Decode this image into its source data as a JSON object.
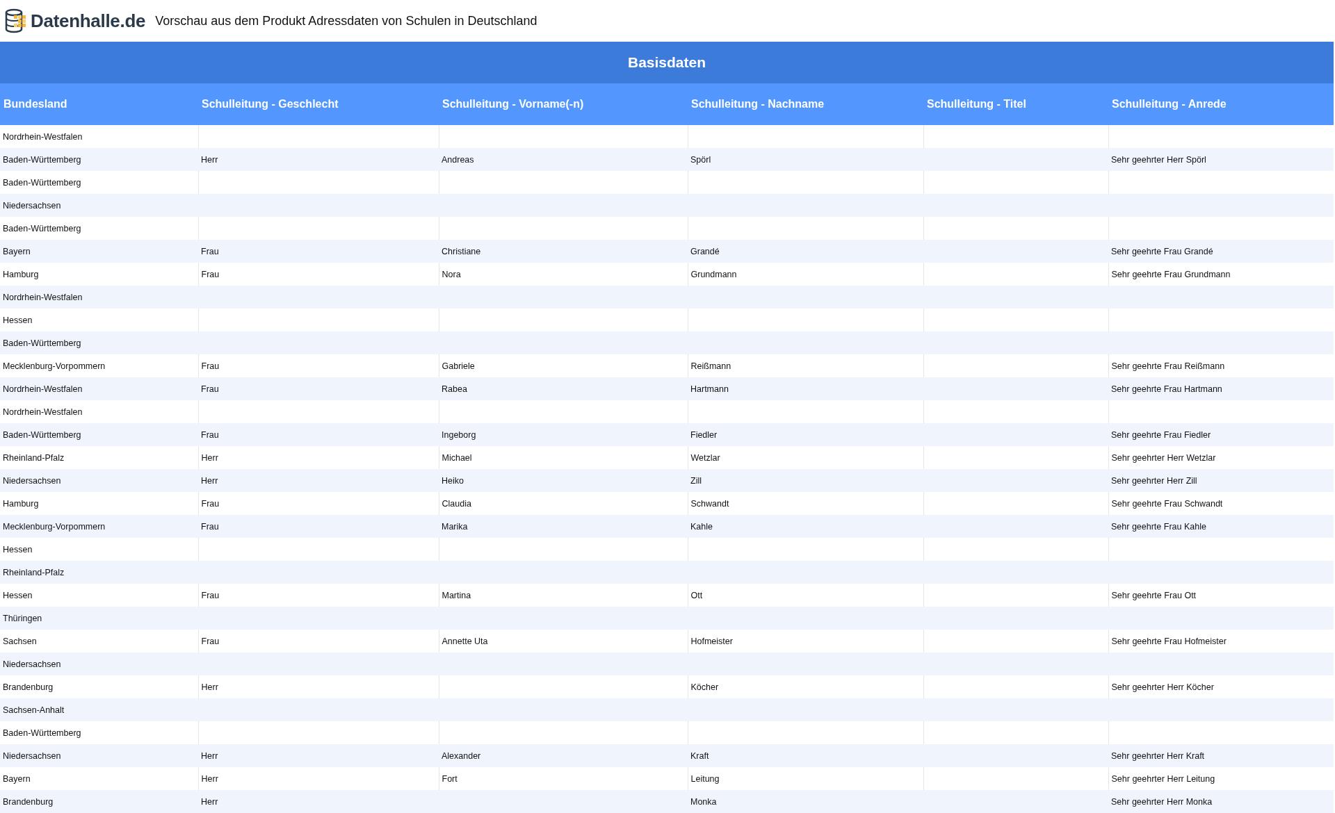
{
  "header": {
    "logo_text": "Datenhalle.de",
    "title": "Vorschau aus dem Produkt Adressdaten von Schulen in Deutschland"
  },
  "table": {
    "group_heading": "Basisdaten",
    "columns": [
      "Bundesland",
      "Schulleitung - Geschlecht",
      "Schulleitung - Vorname(-n)",
      "Schulleitung - Nachname",
      "Schulleitung - Titel",
      "Schulleitung - Anrede"
    ],
    "rows": [
      [
        "Nordrhein-Westfalen",
        "",
        "",
        "",
        "",
        ""
      ],
      [
        "Baden-Württemberg",
        "Herr",
        "Andreas",
        "Spörl",
        "",
        "Sehr geehrter Herr Spörl"
      ],
      [
        "Baden-Württemberg",
        "",
        "",
        "",
        "",
        ""
      ],
      [
        "Niedersachsen",
        "",
        "",
        "",
        "",
        ""
      ],
      [
        "Baden-Württemberg",
        "",
        "",
        "",
        "",
        ""
      ],
      [
        "Bayern",
        "Frau",
        "Christiane",
        "Grandé",
        "",
        "Sehr geehrte Frau Grandé"
      ],
      [
        "Hamburg",
        "Frau",
        "Nora",
        "Grundmann",
        "",
        "Sehr geehrte Frau Grundmann"
      ],
      [
        "Nordrhein-Westfalen",
        "",
        "",
        "",
        "",
        ""
      ],
      [
        "Hessen",
        "",
        "",
        "",
        "",
        ""
      ],
      [
        "Baden-Württemberg",
        "",
        "",
        "",
        "",
        ""
      ],
      [
        "Mecklenburg-Vorpommern",
        "Frau",
        "Gabriele",
        "Reißmann",
        "",
        "Sehr geehrte Frau Reißmann"
      ],
      [
        "Nordrhein-Westfalen",
        "Frau",
        "Rabea",
        "Hartmann",
        "",
        "Sehr geehrte Frau Hartmann"
      ],
      [
        "Nordrhein-Westfalen",
        "",
        "",
        "",
        "",
        ""
      ],
      [
        "Baden-Württemberg",
        "Frau",
        "Ingeborg",
        "Fiedler",
        "",
        "Sehr geehrte Frau Fiedler"
      ],
      [
        "Rheinland-Pfalz",
        "Herr",
        "Michael",
        "Wetzlar",
        "",
        "Sehr geehrter Herr Wetzlar"
      ],
      [
        "Niedersachsen",
        "Herr",
        "Heiko",
        "Zill",
        "",
        "Sehr geehrter Herr Zill"
      ],
      [
        "Hamburg",
        "Frau",
        "Claudia",
        "Schwandt",
        "",
        "Sehr geehrte Frau Schwandt"
      ],
      [
        "Mecklenburg-Vorpommern",
        "Frau",
        "Marika",
        "Kahle",
        "",
        "Sehr geehrte Frau Kahle"
      ],
      [
        "Hessen",
        "",
        "",
        "",
        "",
        ""
      ],
      [
        "Rheinland-Pfalz",
        "",
        "",
        "",
        "",
        ""
      ],
      [
        "Hessen",
        "Frau",
        "Martina",
        "Ott",
        "",
        "Sehr geehrte Frau Ott"
      ],
      [
        "Thüringen",
        "",
        "",
        "",
        "",
        ""
      ],
      [
        "Sachsen",
        "Frau",
        "Annette Uta",
        "Hofmeister",
        "",
        "Sehr geehrte Frau Hofmeister"
      ],
      [
        "Niedersachsen",
        "",
        "",
        "",
        "",
        ""
      ],
      [
        "Brandenburg",
        "Herr",
        "",
        "Köcher",
        "",
        "Sehr geehrter Herr Köcher"
      ],
      [
        "Sachsen-Anhalt",
        "",
        "",
        "",
        "",
        ""
      ],
      [
        "Baden-Württemberg",
        "",
        "",
        "",
        "",
        ""
      ],
      [
        "Niedersachsen",
        "Herr",
        "Alexander",
        "Kraft",
        "",
        "Sehr geehrter Herr Kraft"
      ],
      [
        "Bayern",
        "Herr",
        "Fort",
        "Leitung",
        "",
        "Sehr geehrter Herr Leitung"
      ],
      [
        "Brandenburg",
        "Herr",
        "",
        "Monka",
        "",
        "Sehr geehrter Herr Monka"
      ]
    ]
  }
}
